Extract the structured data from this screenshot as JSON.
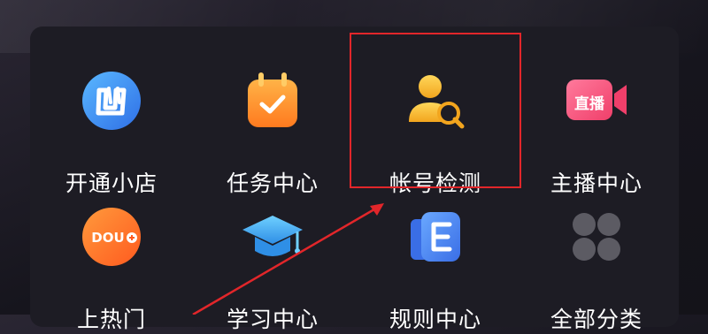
{
  "menu": {
    "items": [
      {
        "label": "开通小店",
        "icon": "store-icon"
      },
      {
        "label": "任务中心",
        "icon": "task-calendar-icon"
      },
      {
        "label": "帐号检测",
        "icon": "account-check-icon"
      },
      {
        "label": "主播中心",
        "icon": "live-camera-icon"
      },
      {
        "label": "上热门",
        "icon": "dou-plus-icon"
      },
      {
        "label": "学习中心",
        "icon": "graduation-cap-icon"
      },
      {
        "label": "规则中心",
        "icon": "rules-book-icon"
      },
      {
        "label": "全部分类",
        "icon": "all-categories-icon"
      }
    ],
    "live_badge_text": "直播",
    "dou_badge_text": "DOU"
  },
  "colors": {
    "highlight_border": "#e2262a",
    "arrow": "#e2262a",
    "panel": "#1d1c24"
  }
}
